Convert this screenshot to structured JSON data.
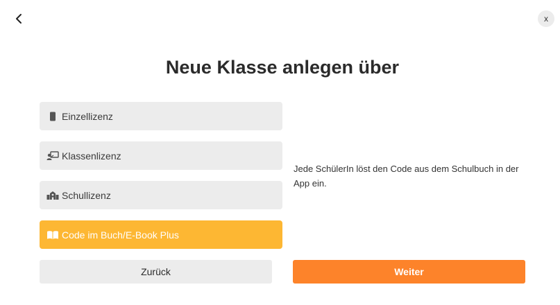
{
  "dialog": {
    "title": "Neue Klasse anlegen über",
    "close_label": "x",
    "options": [
      {
        "label": "Einzellizenz",
        "icon": "tablet-icon",
        "selected": false
      },
      {
        "label": "Klassenlizenz",
        "icon": "presentation-icon",
        "selected": false
      },
      {
        "label": "Schullizenz",
        "icon": "school-icon",
        "selected": false
      },
      {
        "label": "Code im Buch/E-Book Plus",
        "icon": "book-icon",
        "selected": true
      }
    ],
    "description": "Jede SchülerIn löst den Code aus dem Schulbuch in der App ein.",
    "back_button_label": "Zurück",
    "next_button_label": "Weiter"
  },
  "colors": {
    "selected_option": "#fdb733",
    "primary_button": "#fd832a",
    "option_background": "#ececec"
  }
}
